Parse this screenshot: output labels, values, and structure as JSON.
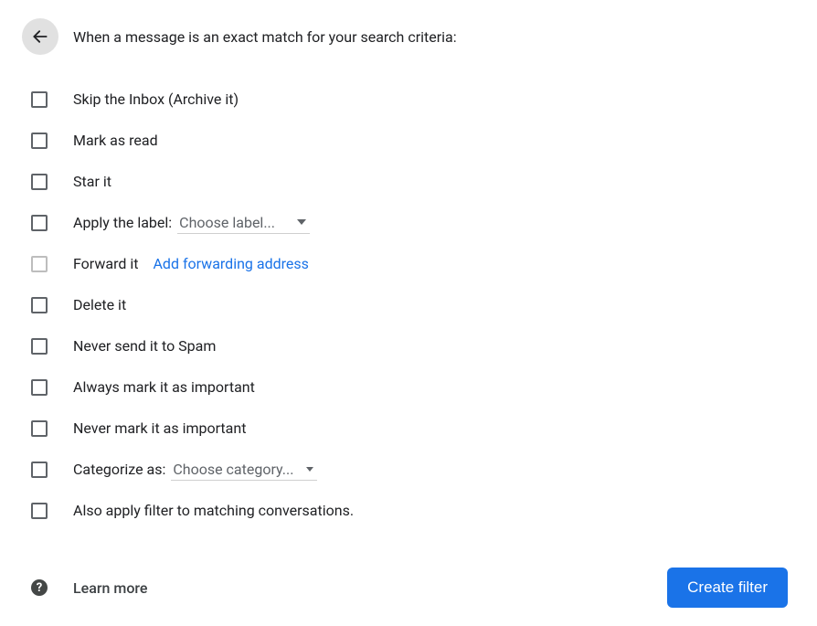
{
  "header": {
    "title": "When a message is an exact match for your search criteria:"
  },
  "options": {
    "skip_inbox": "Skip the Inbox (Archive it)",
    "mark_read": "Mark as read",
    "star_it": "Star it",
    "apply_label": "Apply the label:",
    "apply_label_select": "Choose label...",
    "forward_it": "Forward it",
    "forward_link": "Add forwarding address",
    "delete_it": "Delete it",
    "never_spam": "Never send it to Spam",
    "always_important": "Always mark it as important",
    "never_important": "Never mark it as important",
    "categorize_as": "Categorize as:",
    "categorize_select": "Choose category...",
    "also_apply": "Also apply filter to matching conversations."
  },
  "footer": {
    "learn_more": "Learn more",
    "create_filter": "Create filter"
  }
}
